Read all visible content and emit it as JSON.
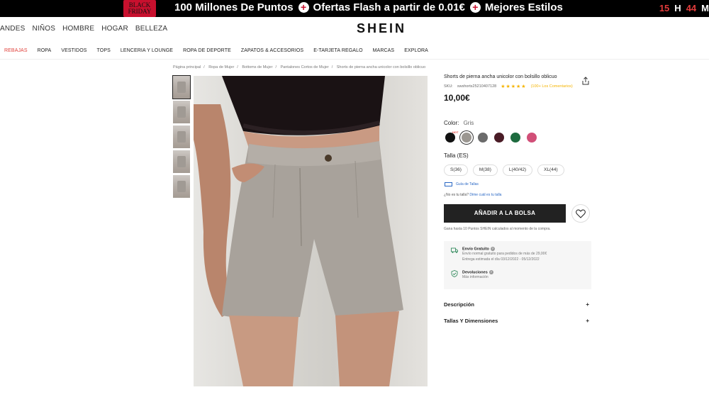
{
  "promo": {
    "logo_line1": "BLACK",
    "logo_line2": "FRIDAY",
    "items": [
      "100 Millones De Puntos",
      "Ofertas Flash a partir de 0.01€",
      "Mejores Estilos"
    ],
    "countdown": {
      "hours": "15",
      "h_label": "H",
      "minutes": "44",
      "m_label": "M"
    }
  },
  "header": {
    "categories": [
      "ANDES",
      "NIÑOS",
      "HOMBRE",
      "HOGAR",
      "BELLEZA"
    ],
    "logo": "SHEIN"
  },
  "subnav": [
    "REBAJAS",
    "ROPA",
    "VESTIDOS",
    "TOPS",
    "LENCERIA Y LOUNGE",
    "ROPA DE DEPORTE",
    "ZAPATOS & ACCESORIOS",
    "E-TARJETA REGALO",
    "MARCAS",
    "EXPLORA"
  ],
  "breadcrumb": [
    "Página principal",
    "Ropa de Mujer",
    "Bottoms de Mujer",
    "Pantalones Cortos de Mujer",
    "Shorts de pierna ancha unicolor con bolsillo oblicuo"
  ],
  "product": {
    "title": "Shorts de pierna ancha unicolor con bolsillo oblicuo",
    "sku_label": "SKU:",
    "sku": "swshorts25210407128",
    "stars": "★★★★★",
    "review_text": "(100+ Los Comentarios)",
    "price": "10,00€",
    "color_label": "Color:",
    "color_value": "Gris",
    "hot_badge": "HOT",
    "swatches": [
      "#111111",
      "#9b9791",
      "#6b6b6b",
      "#4a1c26",
      "#1e6b3f",
      "#d14f78"
    ],
    "size_label": "Talla (ES)",
    "sizes": [
      "S(36)",
      "M(38)",
      "L(40/42)",
      "XL(44)"
    ],
    "size_guide": "Guía de Tallas",
    "size_help_q": "¿No es tu talla?",
    "size_help_link": "Dime cuál es tu talla",
    "add_to_bag": "AÑADIR A LA BOLSA",
    "points_note": "Gana hasta 10 Puntos SHEIN calculados al momento de la compra."
  },
  "shipping": {
    "title": "Envío Gratuito",
    "line1": "Envío normal gratuito para pedidos de más de 29,00€",
    "line2": "Entrega estimada el día 03/12/2022 - 05/12/2022",
    "returns_title": "Devoluciones",
    "returns_sub": "Más información"
  },
  "accordions": [
    "Descripción",
    "Tallas Y Dimensiones"
  ],
  "accordion_symbol": "+"
}
